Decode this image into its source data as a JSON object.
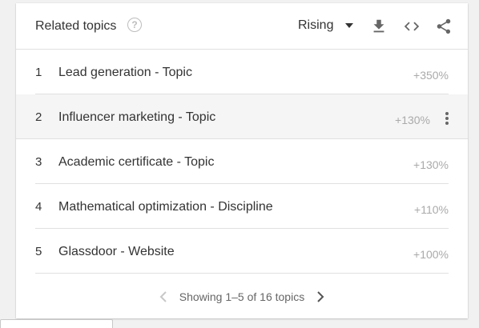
{
  "panel": {
    "title": "Related topics",
    "help_icon": "question-circle-icon",
    "filter_label": "Rising"
  },
  "toolbar": {
    "download_icon": "download-icon",
    "embed_icon": "code-icon",
    "share_icon": "share-icon"
  },
  "rows": [
    {
      "rank": "1",
      "name": "Lead generation - Topic",
      "value": "+350%"
    },
    {
      "rank": "2",
      "name": "Influencer marketing - Topic",
      "value": "+130%"
    },
    {
      "rank": "3",
      "name": "Academic certificate - Topic",
      "value": "+130%"
    },
    {
      "rank": "4",
      "name": "Mathematical optimization - Discipline",
      "value": "+110%"
    },
    {
      "rank": "5",
      "name": "Glassdoor - Website",
      "value": "+100%"
    }
  ],
  "pagination": {
    "text": "Showing 1–5 of 16 topics"
  },
  "colors": {
    "text": "#333333",
    "muted": "#aaaaaa",
    "divider": "#e0e0e0",
    "hover_row": "#f5f5f5"
  }
}
